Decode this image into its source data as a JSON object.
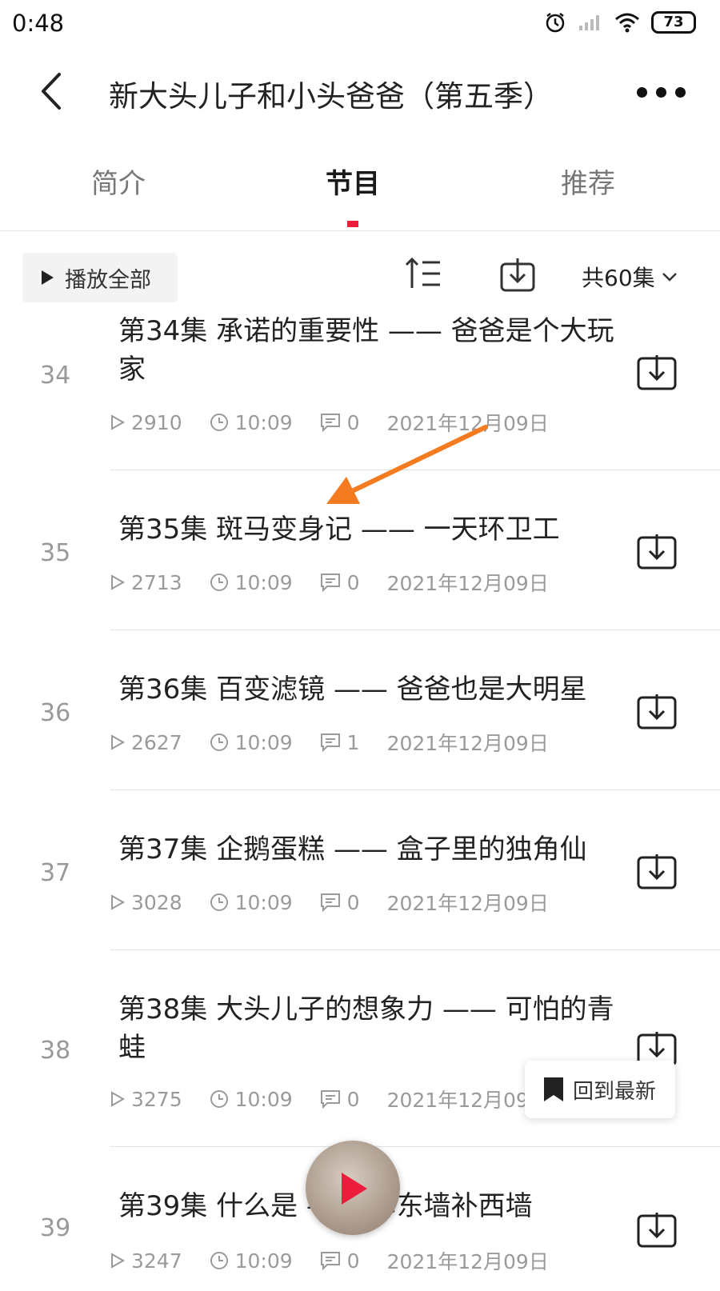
{
  "status_bar": {
    "time": "0:48",
    "battery": "73"
  },
  "header": {
    "title": "新大头儿子和小头爸爸（第五季）"
  },
  "tabs": [
    {
      "label": "简介",
      "active": false
    },
    {
      "label": "节目",
      "active": true
    },
    {
      "label": "推荐",
      "active": false
    }
  ],
  "toolbar": {
    "play_all_label": "播放全部",
    "count_label": "共60集"
  },
  "episodes": [
    {
      "number": "34",
      "title": "第34集 承诺的重要性 —— 爸爸是个大玩家",
      "plays": "2910",
      "duration": "10:09",
      "comments": "0",
      "date": "2021年12月09日"
    },
    {
      "number": "35",
      "title": "第35集 斑马变身记 —— 一天环卫工",
      "plays": "2713",
      "duration": "10:09",
      "comments": "0",
      "date": "2021年12月09日"
    },
    {
      "number": "36",
      "title": "第36集 百变滤镜 —— 爸爸也是大明星",
      "plays": "2627",
      "duration": "10:09",
      "comments": "1",
      "date": "2021年12月09日"
    },
    {
      "number": "37",
      "title": "第37集 企鹅蛋糕 —— 盒子里的独角仙",
      "plays": "3028",
      "duration": "10:09",
      "comments": "0",
      "date": "2021年12月09日"
    },
    {
      "number": "38",
      "title": "第38集 大头儿子的想象力 —— 可怕的青蛙",
      "plays": "3275",
      "duration": "10:09",
      "comments": "0",
      "date": "2021年12月09日"
    },
    {
      "number": "39",
      "title": "第39集 什么是 —— 拆东墙补西墙",
      "plays": "3247",
      "duration": "10:09",
      "comments": "0",
      "date": "2021年12月09日"
    }
  ],
  "floating": {
    "back_to_latest_label": "回到最新"
  },
  "colors": {
    "accent": "#ec1c3c",
    "annotation_arrow": "#f47b20"
  },
  "icons": [
    "back-icon",
    "more-icon",
    "sort-icon",
    "download-icon",
    "play-count-icon",
    "clock-icon",
    "comment-icon",
    "bookmark-icon",
    "play-icon"
  ]
}
